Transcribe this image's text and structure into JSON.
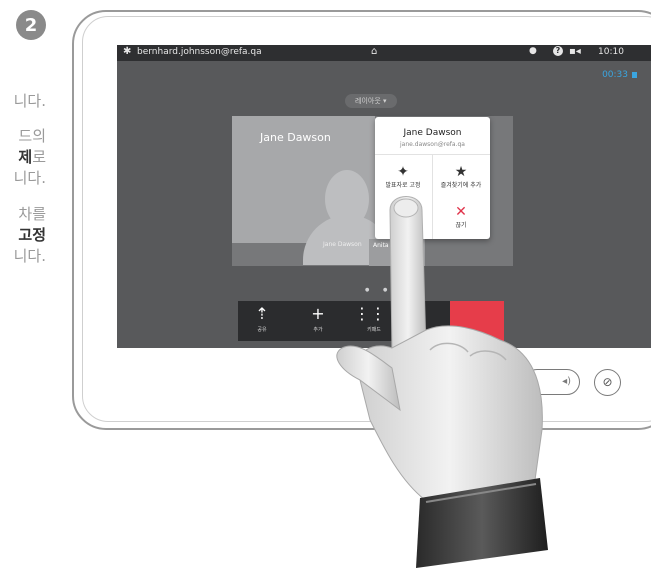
{
  "step": {
    "number": "2"
  },
  "left_text": {
    "line1": "니다.",
    "line2": "드의",
    "line3_bold": "제",
    "line3_rest": "로",
    "line4": "니다.",
    "line5": "차를",
    "line6_bold": "고정",
    "line7": "니다."
  },
  "statusbar": {
    "user": "bernhard.johnsson@refa.qa",
    "gear_icon": "gear-icon",
    "home_icon": "home-icon",
    "bulb_icon": "bulb-icon",
    "help_label": "?",
    "camera_icon": "self-view-icon",
    "time": "10:10"
  },
  "call": {
    "timer": "00:33",
    "layout_button": "레이아웃 ▾",
    "main_participant": "Jane Dawson",
    "thumb_1": "Jane Dawson",
    "thumb_2": "Anita P"
  },
  "popup": {
    "name": "Jane Dawson",
    "email": "jane.dawson@refa.qa",
    "action_pin": "발표자로 고정",
    "action_favorite": "즐겨찾기에 추가",
    "action_end": "끊기"
  },
  "toolbar": {
    "share": "공유",
    "add": "추가",
    "keypad": "키패드"
  },
  "colors": {
    "accent": "#3aa5e0",
    "end_call": "#e63d4a",
    "screen_bg": "#58595b"
  }
}
